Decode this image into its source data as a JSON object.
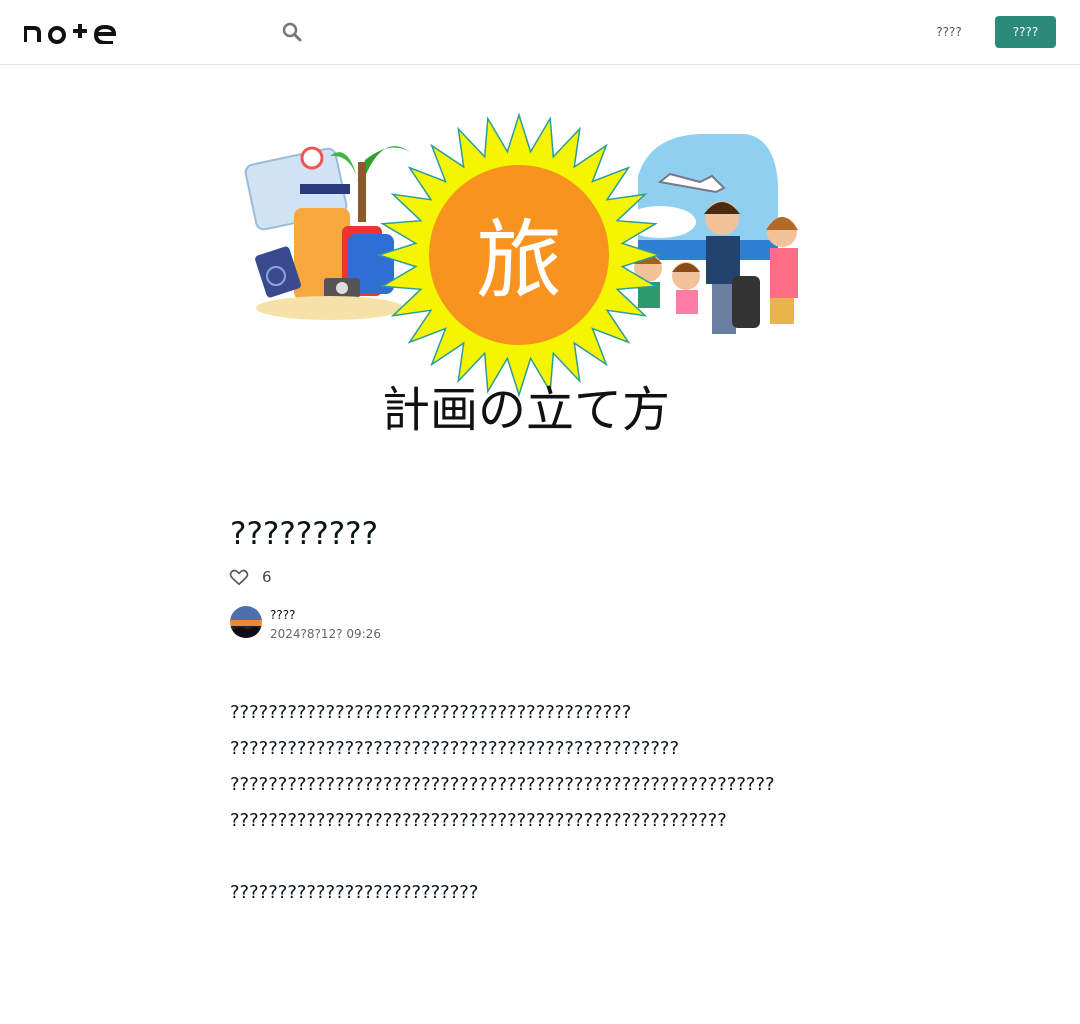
{
  "header": {
    "logo_text": "note",
    "search_icon": "search-icon",
    "login_label": "????",
    "signup_label": "????"
  },
  "hero": {
    "center_char": "旅",
    "caption": "計画の立て方",
    "colors": {
      "sun_center": "#f7931e",
      "sun_rays": "#f5f500",
      "sky": "#8fd0f0"
    }
  },
  "article": {
    "title": "?????????",
    "like_icon": "heart-icon",
    "like_count": "6",
    "author_name": "????",
    "date": "2024?8?12? 09:26",
    "paragraphs": [
      "??????????????????????????????????????????",
      "???????????????????????????????????????????????",
      "?????????????????????????????????????????????????????????",
      "????????????????????????????????????????????????????",
      "",
      "??????????????????????????"
    ]
  },
  "colors": {
    "accent": "#2b8a78",
    "text": "#08131a"
  }
}
